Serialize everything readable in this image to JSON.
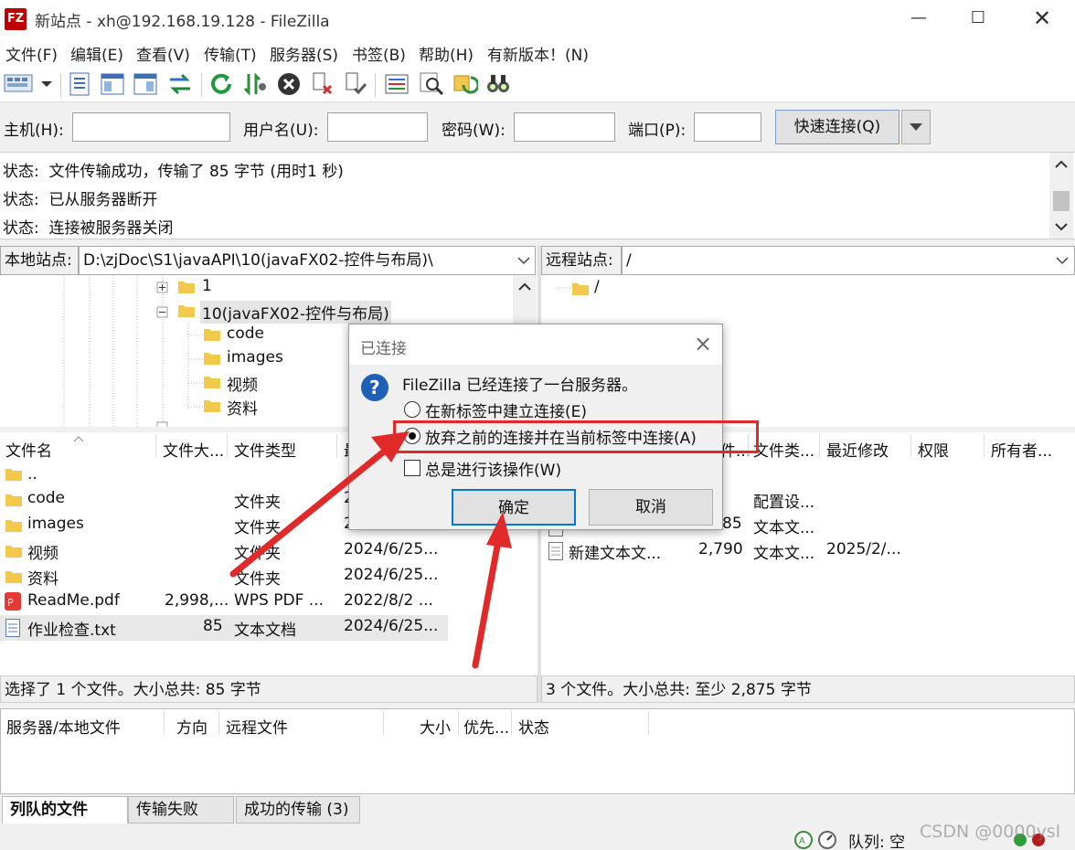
{
  "window": {
    "icon_label": "FZ",
    "title": "新站点 - xh@192.168.19.128 - FileZilla"
  },
  "menu": [
    "文件(F)",
    "编辑(E)",
    "查看(V)",
    "传输(T)",
    "服务器(S)",
    "书签(B)",
    "帮助(H)",
    "有新版本！(N)"
  ],
  "quickconnect": {
    "host_label": "主机(H):",
    "user_label": "用户名(U):",
    "password_label": "密码(W):",
    "port_label": "端口(P):",
    "host_value": "",
    "user_value": "",
    "password_value": "",
    "port_value": "",
    "connect_label": "快速连接(Q)"
  },
  "log": [
    {
      "label": "状态:",
      "text": "文件传输成功，传输了 85 字节 (用时1 秒)"
    },
    {
      "label": "状态:",
      "text": "已从服务器断开"
    },
    {
      "label": "状态:",
      "text": "连接被服务器关闭"
    }
  ],
  "local": {
    "site_label": "本地站点:",
    "path": "D:\\zjDoc\\S1\\javaAPI\\10(javaFX02-控件与布局)\\",
    "tree": [
      {
        "name": "1"
      },
      {
        "name": "10(javaFX02-控件与布局)"
      },
      {
        "name": "code"
      },
      {
        "name": "images"
      },
      {
        "name": "视频"
      },
      {
        "name": "资料"
      }
    ],
    "columns": {
      "name": "文件名",
      "size": "文件大...",
      "type": "文件类型",
      "modified": "最"
    },
    "files": [
      {
        "name": "..",
        "size": "",
        "type": "",
        "modified": ""
      },
      {
        "name": "code",
        "size": "",
        "type": "文件夹",
        "modified": "2"
      },
      {
        "name": "images",
        "size": "",
        "type": "文件夹",
        "modified": "2024/6/25..."
      },
      {
        "name": "视频",
        "size": "",
        "type": "文件夹",
        "modified": "2024/6/25..."
      },
      {
        "name": "资料",
        "size": "",
        "type": "文件夹",
        "modified": "2024/6/25..."
      },
      {
        "name": "ReadMe.pdf",
        "size": "2,998,...",
        "type": "WPS PDF ...",
        "modified": "2022/8/2 ..."
      },
      {
        "name": "作业检查.txt",
        "size": "85",
        "type": "文本文档",
        "modified": "2024/6/25..."
      }
    ],
    "status": "选择了 1 个文件。大小总共: 85 字节"
  },
  "remote": {
    "site_label": "远程站点:",
    "path": "/",
    "tree": [
      {
        "name": "/"
      }
    ],
    "columns": {
      "size": "件...",
      "type": "文件类...",
      "modified": "最近修改",
      "perms": "权限",
      "owner": "所有者..."
    },
    "files": [
      {
        "name": "",
        "size": "",
        "type": "配置设...",
        "modified": ""
      },
      {
        "name": "",
        "size": "85",
        "type": "文本文...",
        "modified": ""
      },
      {
        "name": "新建文本文...",
        "size": "2,790",
        "type": "文本文...",
        "modified": "2025/2/..."
      }
    ],
    "status": "3 个文件。大小总共: 至少 2,875 字节"
  },
  "queue": {
    "columns": [
      "服务器/本地文件",
      "方向",
      "远程文件",
      "大小",
      "优先...",
      "状态"
    ],
    "tabs": [
      "列队的文件",
      "传输失败",
      "成功的传输 (3)"
    ],
    "queue_status": "队列: 空"
  },
  "dialog": {
    "title": "已连接",
    "message": "FileZilla 已经连接了一台服务器。",
    "option_new_tab": "在新标签中建立连接(E)",
    "option_abort": "放弃之前的连接并在当前标签中连接(A)",
    "always_label": "总是进行该操作(W)",
    "ok_label": "确定",
    "cancel_label": "取消"
  },
  "watermark": "CSDN @0000ysl",
  "colors": {
    "accent_blue": "#1565c0",
    "annotation_red": "#e02a2a",
    "folder_yellow": "#f2c94c"
  }
}
